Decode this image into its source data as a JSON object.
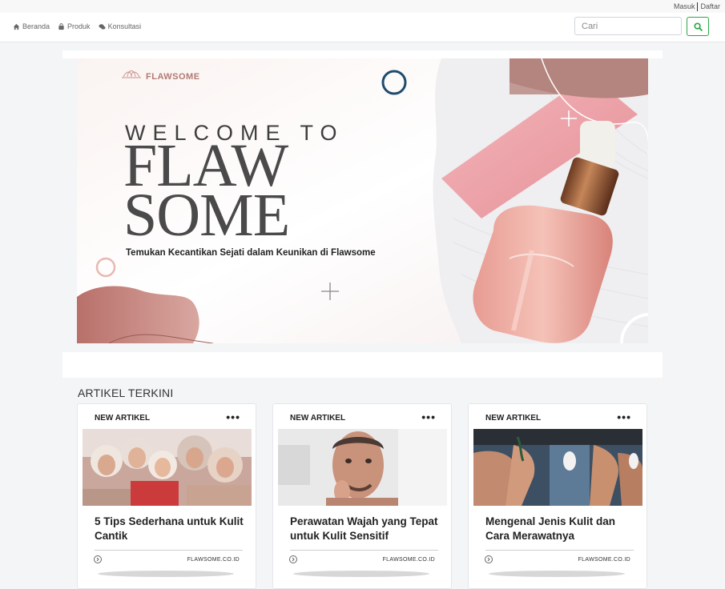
{
  "auth": {
    "login": "Masuk",
    "register": "Daftar"
  },
  "nav": {
    "items": [
      {
        "label": "Beranda",
        "icon": "home-icon"
      },
      {
        "label": "Produk",
        "icon": "bag-icon"
      },
      {
        "label": "Konsultasi",
        "icon": "chat-icon"
      }
    ]
  },
  "search": {
    "placeholder": "Cari",
    "button_icon": "search-icon",
    "accent": "#28a745"
  },
  "banner": {
    "brand": "FLAWSOME",
    "welcome": "WELCOME TO",
    "line1": "FLAW",
    "line2": "SOME",
    "tagline": "Temukan Kecantikan Sejati dalam Keunikan di Flawsome",
    "colors": {
      "blob": "#c9837b",
      "pink": "#f0a8ae",
      "ring": "#1e4c6e"
    }
  },
  "section": {
    "title": "ARTIKEL TERKINI"
  },
  "articles": [
    {
      "tag": "NEW ARTIKEL",
      "menu": "•••",
      "title": "5 Tips Sederhana untuk Kulit Cantik",
      "source": "FLAWSOME.CO.ID"
    },
    {
      "tag": "NEW ARTIKEL",
      "menu": "•••",
      "title": "Perawatan Wajah yang Tepat untuk Kulit Sensitif",
      "source": "FLAWSOME.CO.ID"
    },
    {
      "tag": "NEW ARTIKEL",
      "menu": "•••",
      "title": "Mengenal Jenis Kulit dan Cara Merawatnya",
      "source": "FLAWSOME.CO.ID"
    }
  ]
}
